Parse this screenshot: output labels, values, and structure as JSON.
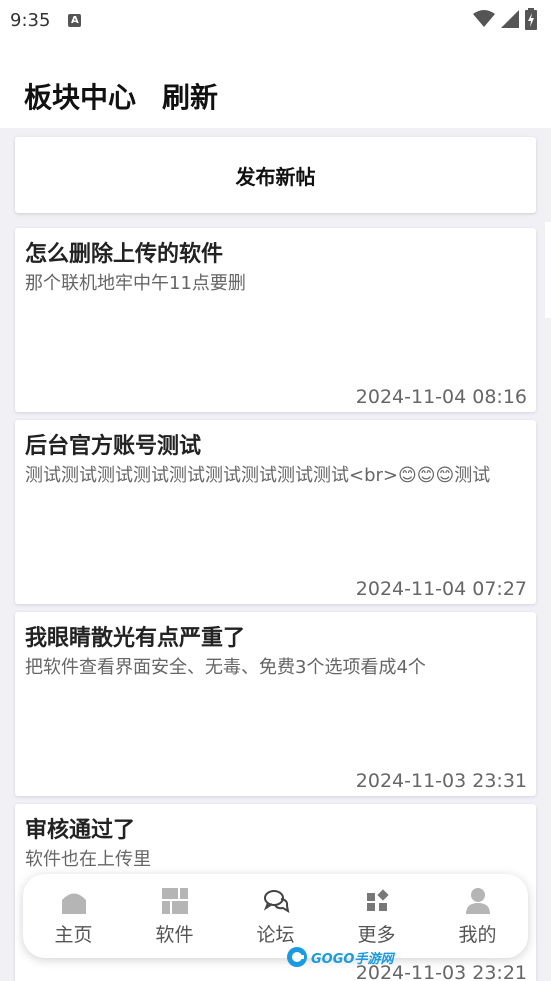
{
  "status_bar": {
    "time": "9:35",
    "notification_badge": "A",
    "icons": [
      "wifi-icon",
      "signal-icon",
      "battery-icon"
    ]
  },
  "header": {
    "title": "板块中心",
    "refresh_label": "刷新"
  },
  "publish": {
    "label": "发布新帖"
  },
  "posts": [
    {
      "title": "怎么删除上传的软件",
      "body": "那个联机地牢中午11点要删",
      "time": "2024-11-04 08:16"
    },
    {
      "title": "后台官方账号测试",
      "body": "测试测试测试测试测试测试测试测试测试<br>😊😊😊测试",
      "time": "2024-11-04 07:27"
    },
    {
      "title": "我眼睛散光有点严重了",
      "body": "把软件查看界面安全、无毒、免费3个选项看成4个",
      "time": "2024-11-03 23:31"
    },
    {
      "title": "审核通过了",
      "body": "软件也在上传里",
      "time": "2024-11-03 23:21"
    }
  ],
  "nav": {
    "items": [
      {
        "label": "主页",
        "icon": "home-icon"
      },
      {
        "label": "软件",
        "icon": "grid-icon"
      },
      {
        "label": "论坛",
        "icon": "chat-icon"
      },
      {
        "label": "更多",
        "icon": "more-icon"
      },
      {
        "label": "我的",
        "icon": "user-icon"
      }
    ]
  },
  "watermark": {
    "text": "GOGO手游网"
  },
  "colors": {
    "background": "#f0f0f5",
    "card": "#ffffff",
    "title_text": "#222222",
    "secondary_text": "#666666",
    "nav_icon": "#b5b5b5",
    "watermark": "#1a9be0"
  }
}
